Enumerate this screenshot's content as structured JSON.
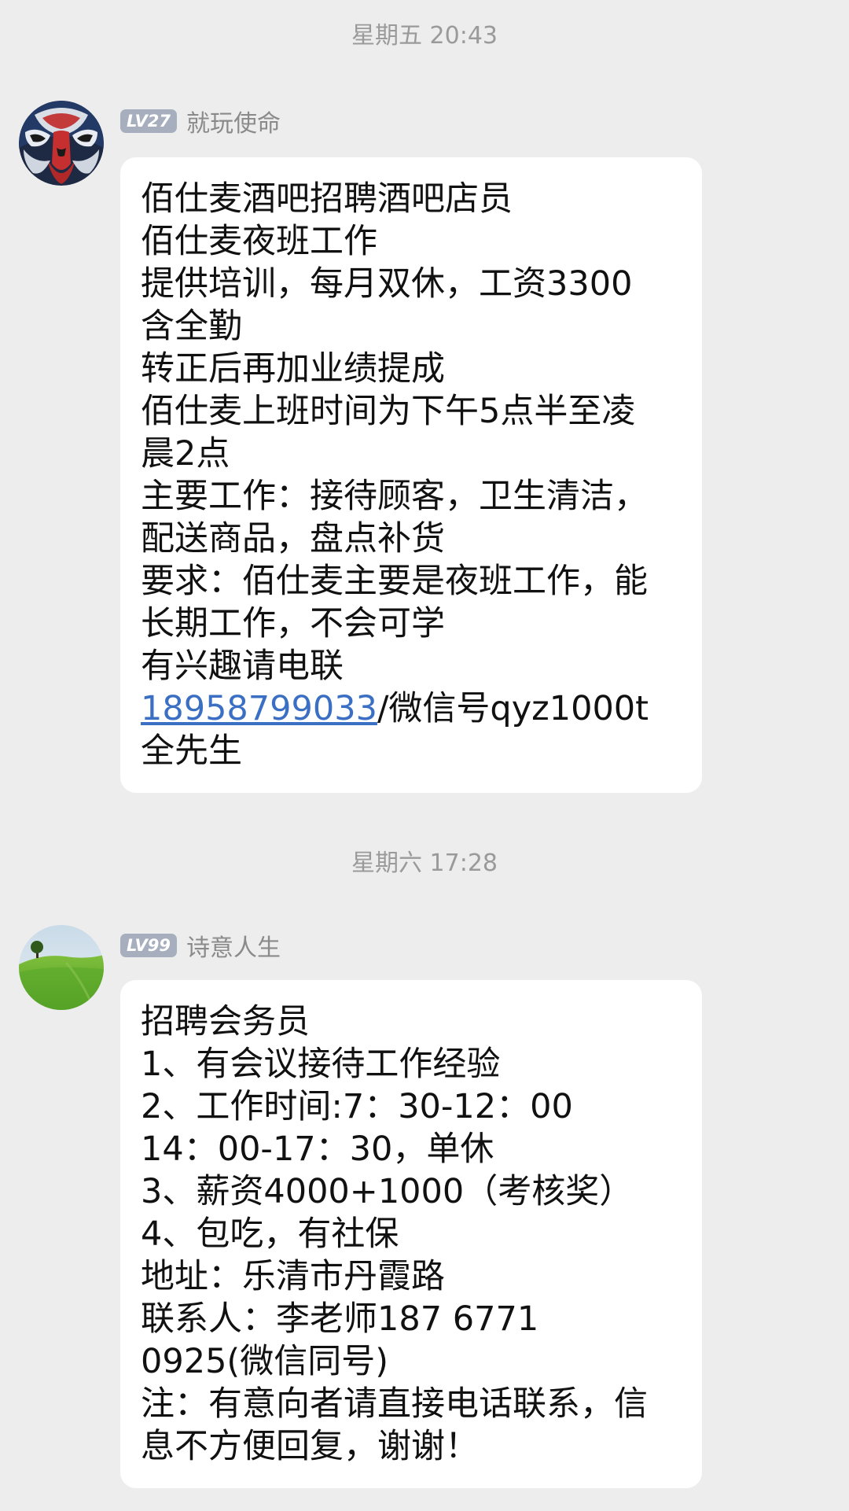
{
  "chat": {
    "messages": [
      {
        "timestamp": "星期五 20:43",
        "level": "LV27",
        "sender": "就玩使命",
        "lines": [
          "佰仕麦酒吧招聘酒吧店员",
          "佰仕麦夜班工作",
          "提供培训，每月双休，工资3300",
          "含全勤",
          "转正后再加业绩提成",
          "佰仕麦上班时间为下午5点半至凌",
          "晨2点",
          "主要工作：接待顾客，卫生清洁，",
          "配送商品，盘点补货",
          "要求：佰仕麦主要是夜班工作，能",
          "长期工作，不会可学",
          "有兴趣请电联"
        ],
        "phone_link": "18958799033",
        "wechat_suffix": "/微信号qyz1000t",
        "contact_name": "全先生"
      },
      {
        "timestamp": "星期六 17:28",
        "level": "LV99",
        "sender": "诗意人生",
        "lines": [
          "招聘会务员",
          "1、有会议接待工作经验",
          "2、工作时间:7：30-12：00",
          "14：00-17：30，单休",
          "3、薪资4000+1000（考核奖）",
          "4、包吃，有社保",
          "地址：乐清市丹霞路",
          "联系人：李老师187 6771",
          "0925(微信同号)",
          "注：有意向者请直接电话联系，信",
          "息不方便回复，谢谢！"
        ]
      }
    ]
  },
  "icons": {
    "avatar_1": "opera-mask-avatar-icon",
    "avatar_2": "green-hill-landscape-avatar-icon"
  },
  "colors": {
    "background": "#ededed",
    "bubble": "#ffffff",
    "link": "#3a6fc4",
    "level_badge": "#a7afbf"
  }
}
